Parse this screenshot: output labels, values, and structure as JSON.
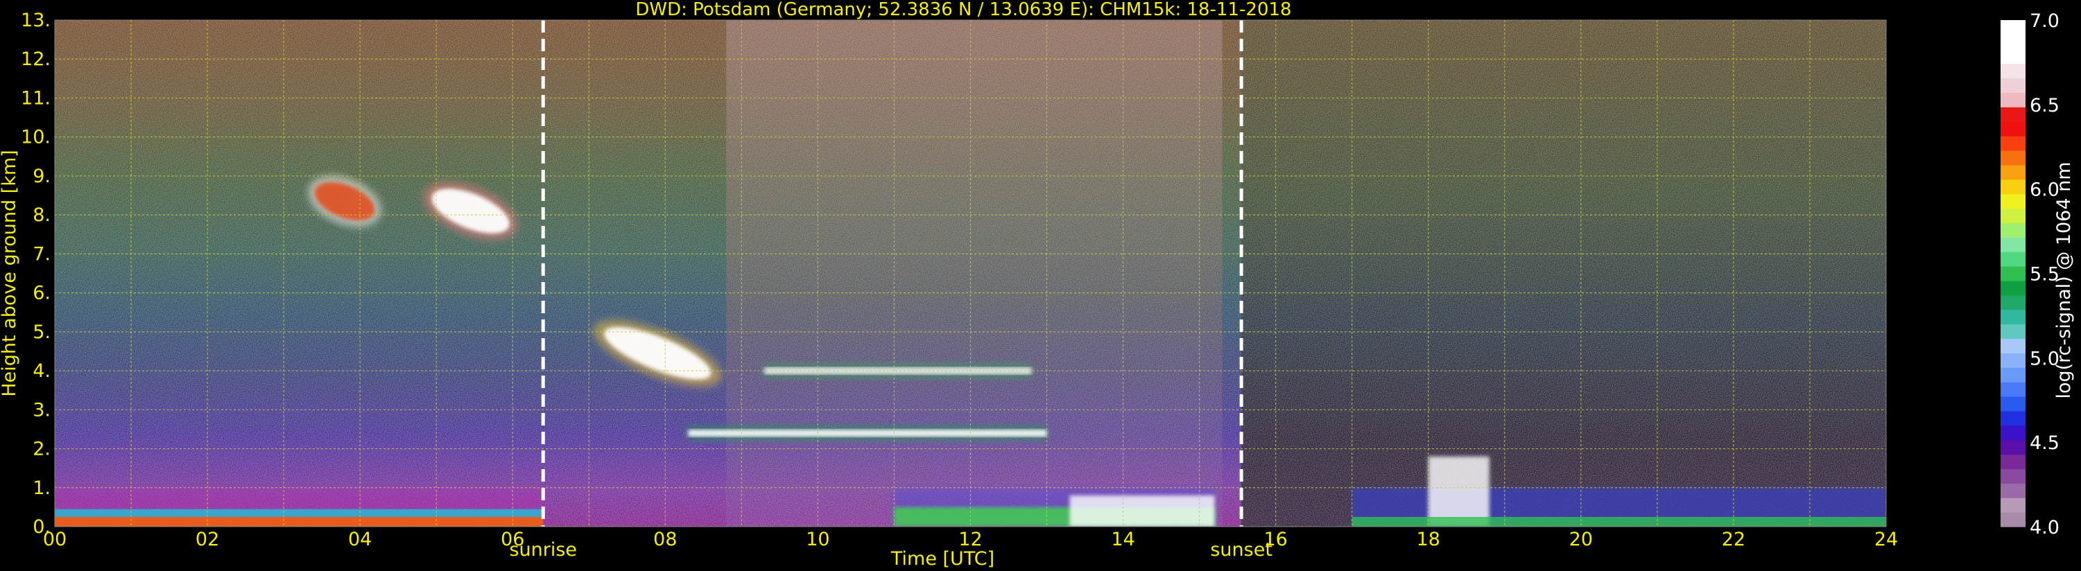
{
  "chart_data": {
    "type": "heatmap",
    "title": "DWD: Potsdam (Germany; 52.3836 N / 13.0639 E):    CHM15k: 18-11-2018",
    "xlabel": "Time [UTC]",
    "ylabel": "Height above ground [km]",
    "xlim": [
      0,
      24
    ],
    "ylim": [
      0,
      13
    ],
    "xticks": [
      "00",
      "02",
      "04",
      "06",
      "08",
      "10",
      "12",
      "14",
      "16",
      "18",
      "20",
      "22",
      "24"
    ],
    "yticks": [
      "0.",
      "1.",
      "2.",
      "3.",
      "4.",
      "5.",
      "6.",
      "7.",
      "8.",
      "9.",
      "10.",
      "11.",
      "12.",
      "13."
    ],
    "grid": true,
    "events": [
      {
        "label": "sunrise",
        "x": 6.4
      },
      {
        "label": "sunset",
        "x": 15.55
      }
    ],
    "colorbar": {
      "label": "log(rc-signal) @ 1064 nm",
      "range": [
        4.0,
        7.0
      ],
      "ticks": [
        "4.0",
        "4.5",
        "5.0",
        "5.5",
        "6.0",
        "6.5",
        "7.0"
      ],
      "colors": [
        "#a68aa6",
        "#b89ab8",
        "#9b6ba8",
        "#8a4aa0",
        "#7a2a98",
        "#5a10a8",
        "#3a10c8",
        "#2030e0",
        "#2a5af0",
        "#4a7af8",
        "#6a9af8",
        "#8ab2f8",
        "#a8c8f8",
        "#60c8c0",
        "#30b8a0",
        "#20a868",
        "#10a040",
        "#30c050",
        "#50d880",
        "#80e8a0",
        "#a0f070",
        "#d0f040",
        "#f0f020",
        "#f8d010",
        "#f8a010",
        "#f87010",
        "#f84010",
        "#f01010",
        "#e81818",
        "#f0b8c0",
        "#f0d0d8",
        "#f4e4e8",
        "#ffffff",
        "#ffffff",
        "#ffffff"
      ]
    },
    "features": [
      {
        "name": "cirrus-1",
        "x": [
          3.3,
          4.3
        ],
        "y": [
          7.6,
          9.1
        ]
      },
      {
        "name": "cirrus-2",
        "x": [
          4.8,
          6.1
        ],
        "y": [
          7.3,
          8.9
        ]
      },
      {
        "name": "mid-cloud-1",
        "x": [
          7.0,
          8.8
        ],
        "y": [
          3.7,
          5.2
        ]
      },
      {
        "name": "mid-cloud-layer",
        "x": [
          9.3,
          12.8
        ],
        "y": [
          3.7,
          4.3
        ]
      },
      {
        "name": "low-cloud-layer",
        "x": [
          8.3,
          13.0
        ],
        "y": [
          2.1,
          2.7
        ]
      },
      {
        "name": "boundary-layer-1",
        "x": [
          0,
          6.4
        ],
        "y": [
          0,
          0.45
        ]
      },
      {
        "name": "boundary-layer-2",
        "x": [
          11.0,
          15.2
        ],
        "y": [
          0,
          1.0
        ]
      },
      {
        "name": "evening-low-cloud",
        "x": [
          17.0,
          24.0
        ],
        "y": [
          0,
          1.8
        ]
      }
    ]
  }
}
